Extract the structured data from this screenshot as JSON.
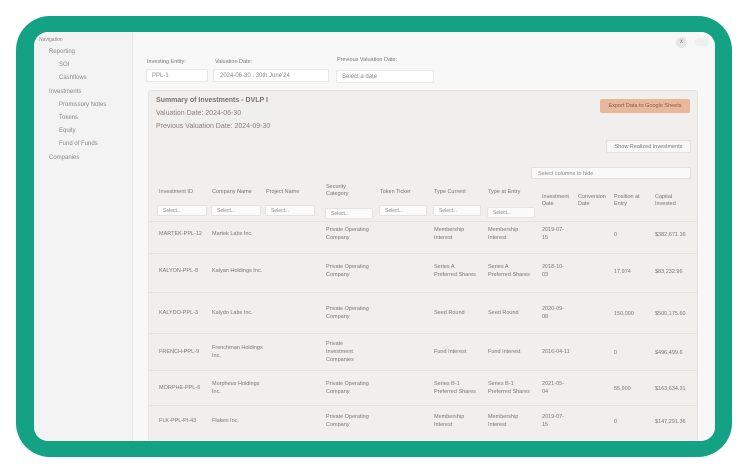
{
  "sidebar": {
    "heading": "Navigation",
    "items": [
      {
        "label": "Reporting",
        "level": 0
      },
      {
        "label": "SOI",
        "level": 1
      },
      {
        "label": "Cashflows",
        "level": 1
      },
      {
        "label": "Investments",
        "level": 0
      },
      {
        "label": "Promissory Notes",
        "level": 1
      },
      {
        "label": "Tokens",
        "level": 1
      },
      {
        "label": "Equity",
        "level": 1
      },
      {
        "label": "Fund of Funds",
        "level": 1
      },
      {
        "label": "Companies",
        "level": 0
      }
    ]
  },
  "topbar": {
    "close_label": "x"
  },
  "filters": {
    "investing_entity": {
      "label": "Investing Entity:",
      "value": "PPL-1"
    },
    "valuation_date": {
      "label": "Valuation Date:",
      "value": "2024-06-30 : 30th June'24"
    },
    "previous_valuation_date": {
      "label": "Previous Valuation Date:",
      "placeholder": "Select a date"
    }
  },
  "summary": {
    "title": "Summary of Investments - DVLP I",
    "valuation_date": "Valuation Date:  2024-06-30",
    "previous_valuation_date": "Previous Valuation Date:  2024-09-30",
    "export_label": "Export Data to Google Sheets",
    "show_realized_label": "Show Realized Investments",
    "columns_placeholder": "Select columns to hide"
  },
  "table": {
    "filter_placeholder": "Select...",
    "columns": [
      "Investment ID",
      "Company Name",
      "Project Name",
      "Security\nCategory",
      "Token Ticker",
      "Type Current",
      "Type at Entry",
      "Investment\nDate",
      "Conversion\nDate",
      "Position at\nEntry",
      "Capital\nInvested"
    ],
    "rows": [
      [
        "MARTEK-PPL-12",
        "Martek Labs Inc.",
        "",
        "Private Operating\nCompany",
        "",
        "Membership\nInterest",
        "Membership\nInterest",
        "2019-07-\n15",
        "",
        "0",
        "$382,671.16"
      ],
      [
        "KALYON-PPL-8",
        "Kalyan Holdings Inc.",
        "",
        "Private Operating\nCompany",
        "",
        "Series A\nPreferred Shares",
        "Series A\nPreferred Shares",
        "2018-10-\n03",
        "",
        "17,974",
        "$83,232.96"
      ],
      [
        "KALYDO-PPL-3",
        "Kalydo Labs Inc.",
        "",
        "Private Operating\nCompany",
        "",
        "Seed Round",
        "Seed Round",
        "2020-09-\n08",
        "",
        "150,000",
        "$500,175.60"
      ],
      [
        "FRENCH-PPL-9",
        "Frenchman Holdings\nInc.",
        "",
        "Private\nInvestment\nCompanies",
        "",
        "Fund Interest",
        "Fund Interest",
        "2016-04-11",
        "",
        "0",
        "$496,499.6"
      ],
      [
        "MORPHE-PPL-6",
        "Morpheus Holdings\nInc.",
        "",
        "Private Operating\nCompany",
        "",
        "Series B-1\nPreferred Shares",
        "Series B-1\nPreferred Shares",
        "2021-05-\n04",
        "",
        "55,909",
        "$163,634.31"
      ],
      [
        "FLK-PPL-PI-43",
        "Flaken Inc.",
        "",
        "Private Operating\nCompany",
        "",
        "Membership\nInterest",
        "Membership\nInterest",
        "2019-07-\n15",
        "",
        "0",
        "$147,291.36"
      ]
    ]
  }
}
